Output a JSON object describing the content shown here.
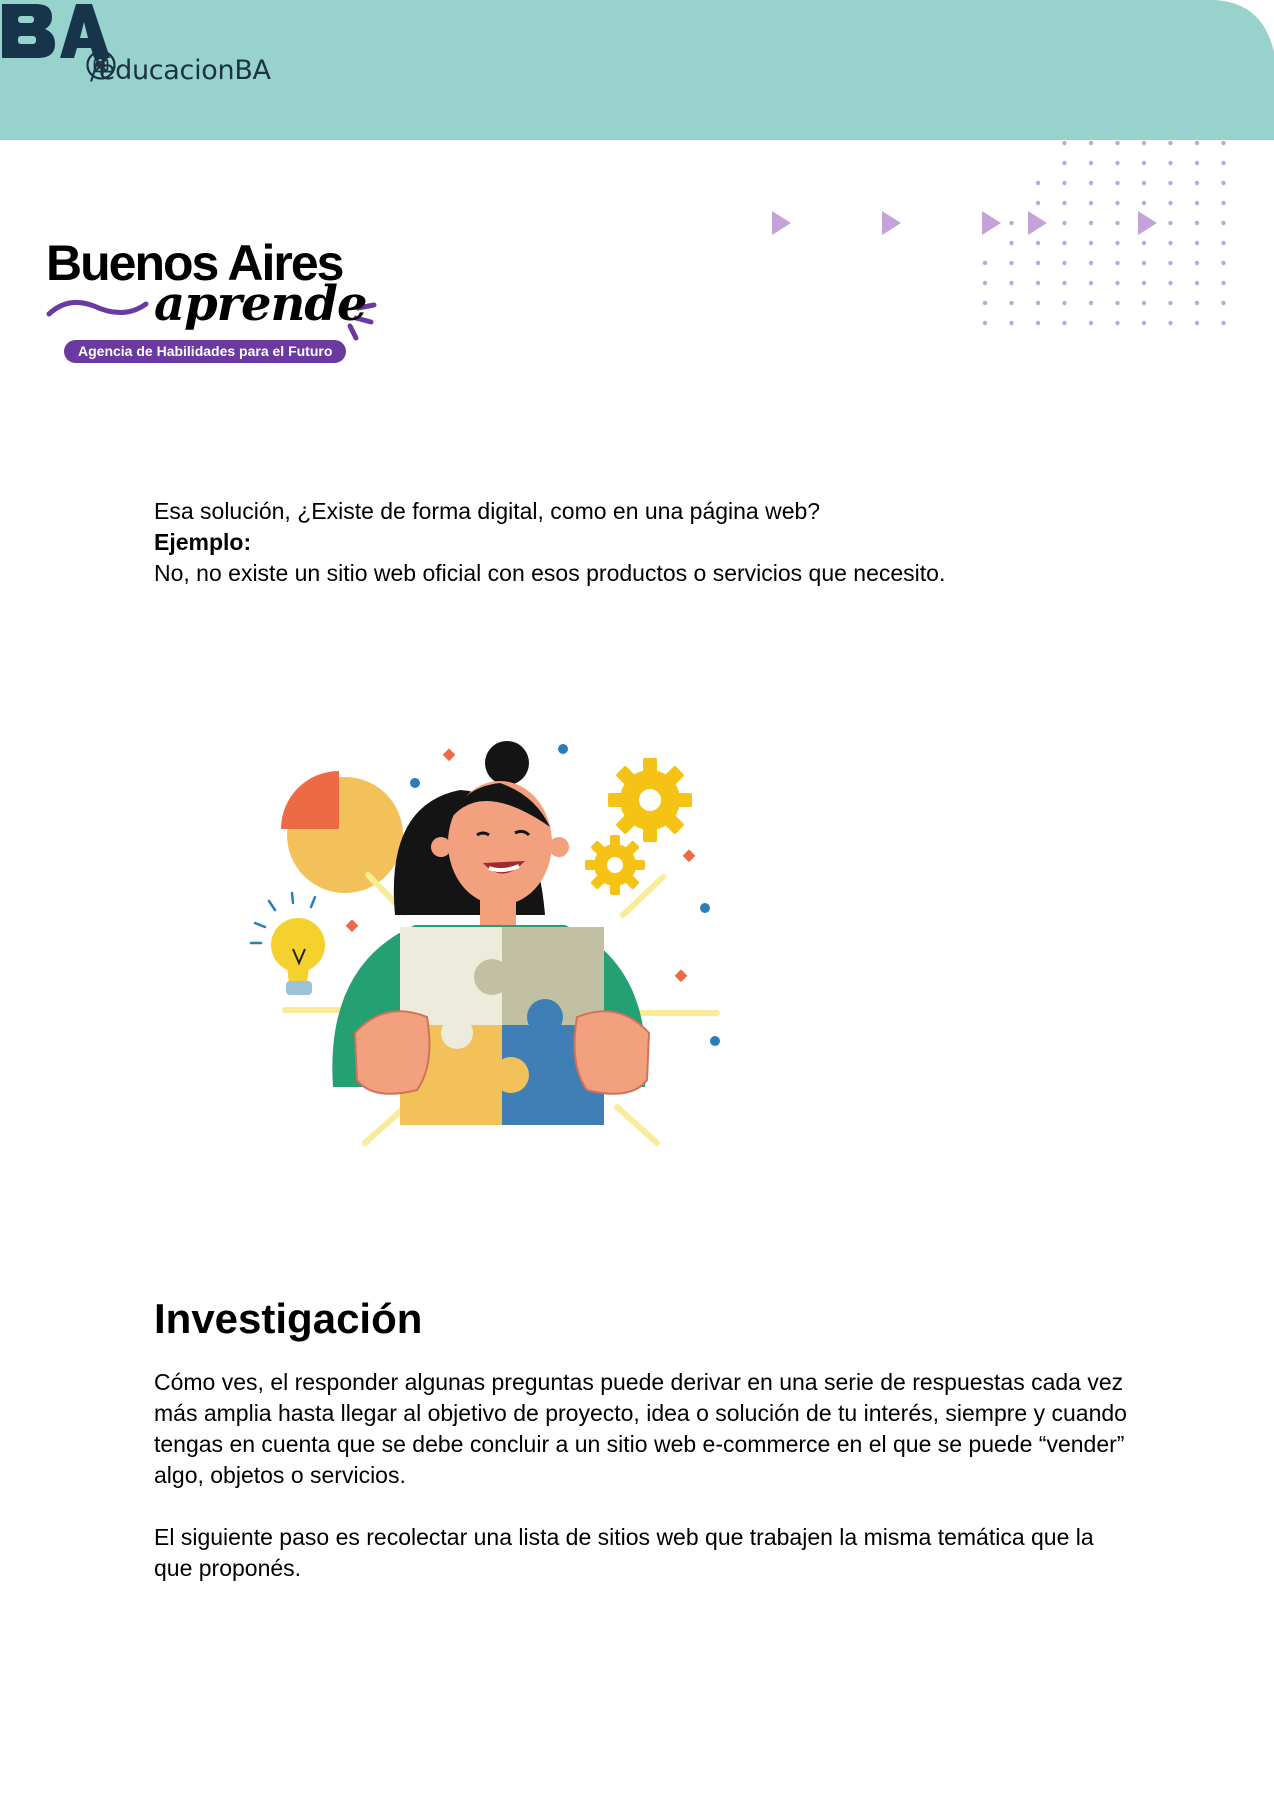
{
  "header": {
    "handle": "/educacionBA",
    "social_icons": [
      "instagram-icon",
      "x-icon",
      "facebook-icon"
    ],
    "brand": "BA",
    "bg_color": "#98d2cd",
    "brand_color": "#16354a"
  },
  "logo": {
    "line1": "Buenos Aires",
    "line2": "aprende",
    "tagline": "Agencia de Habilidades para el Futuro",
    "accent_color": "#6b3aa0"
  },
  "section1": {
    "question": "Esa solución, ¿Existe de forma digital, como en una página web?",
    "example_label": "Ejemplo:",
    "example_text": "No, no existe un sitio web oficial con esos productos o servicios que necesito."
  },
  "section2": {
    "heading": "Investigación",
    "para1": "Cómo ves, el responder algunas preguntas puede derivar en una serie de respuestas cada vez más amplia hasta llegar al objetivo de proyecto, idea o solución de tu interés, siempre y cuando tengas en cuenta que se debe concluir a un sitio web e-commerce en el que se puede “vender” algo, objetos o servicios.",
    "para2": "El siguiente paso es recolectar una lista de sitios web que trabajen la misma temática que la que proponés."
  },
  "colors": {
    "deco_purple": "#c3a3d8"
  }
}
